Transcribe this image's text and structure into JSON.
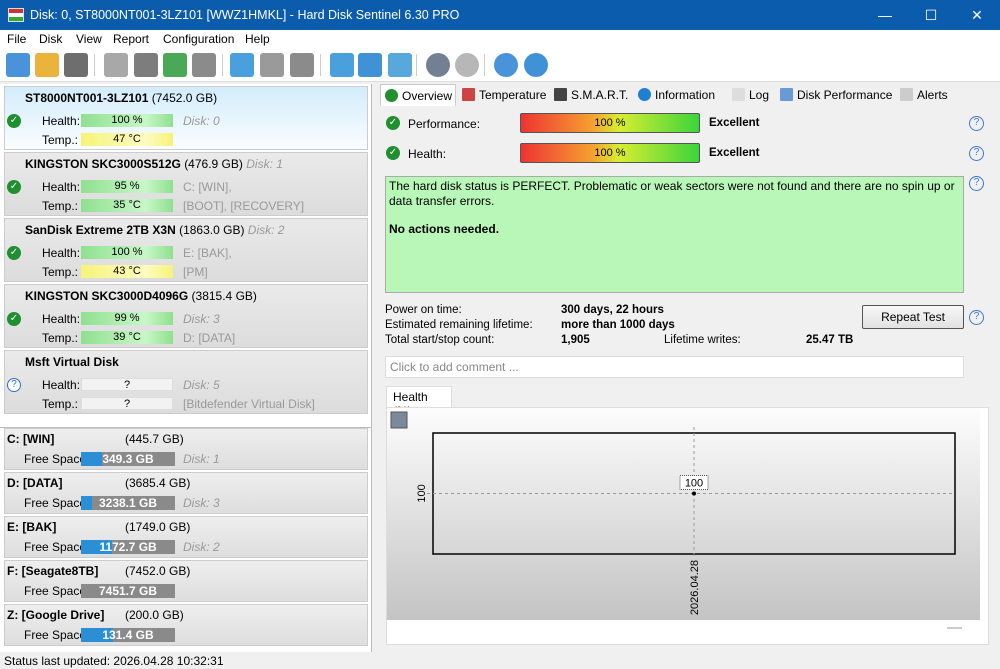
{
  "window": {
    "title": "Disk: 0, ST8000NT001-3LZ101 [WWZ1HMKL]  -  Hard Disk Sentinel 6.30 PRO",
    "minimize": "—",
    "maximize": "☐",
    "close": "✕"
  },
  "menu": [
    "File",
    "Disk",
    "View",
    "Report",
    "Configuration",
    "Help"
  ],
  "toolbar": [
    "refresh-icon",
    "refresh-warning-icon",
    "disk-list-icon",
    "disk-gray-icon",
    "disk-schedule-icon",
    "disk-check-icon",
    "disk-search-icon",
    "network-disk-icon",
    "usb-disk-icon",
    "external-disk-icon",
    "report-icon",
    "email-icon",
    "network-icon",
    "settings-icon",
    "sound-icon",
    "help-icon",
    "info-icon"
  ],
  "disks": [
    {
      "name": "ST8000NT001-3LZ101",
      "size": "(7452.0 GB)",
      "disk_inline": "",
      "status": "ok",
      "health_label": "Health:",
      "health": "100 %",
      "health_color": "g",
      "temp_label": "Temp.:",
      "temp": "47 °C",
      "temp_color": "y",
      "side1": "Disk: 0",
      "side2": "",
      "selected": true
    },
    {
      "name": "KINGSTON SKC3000S512G",
      "size": "(476.9 GB)",
      "disk_inline": "Disk: 1",
      "status": "ok",
      "health_label": "Health:",
      "health": "95 %",
      "health_color": "g",
      "temp_label": "Temp.:",
      "temp": "35 °C",
      "temp_color": "g",
      "side1": "C: [WIN],",
      "side2": "[BOOT],  [RECOVERY]"
    },
    {
      "name": "SanDisk Extreme 2TB X3N",
      "size": "(1863.0 GB)",
      "disk_inline": "Disk: 2",
      "status": "ok",
      "health_label": "Health:",
      "health": "100 %",
      "health_color": "g",
      "temp_label": "Temp.:",
      "temp": "43 °C",
      "temp_color": "y",
      "side1": "E: [BAK],",
      "side2": "[PM]"
    },
    {
      "name": "KINGSTON SKC3000D4096G",
      "size": "(3815.4 GB)",
      "disk_inline": "",
      "status": "ok",
      "health_label": "Health:",
      "health": "99 %",
      "health_color": "g",
      "temp_label": "Temp.:",
      "temp": "39 °C",
      "temp_color": "g",
      "side1": "Disk: 3",
      "side2": "D: [DATA]"
    },
    {
      "name": "Msft    Virtual Disk",
      "size": "",
      "disk_inline": "",
      "status": "unknown",
      "health_label": "Health:",
      "health": "?",
      "health_color": "e",
      "temp_label": "Temp.:",
      "temp": "?",
      "temp_color": "e",
      "side1": "Disk: 5",
      "side2": "[Bitdefender Virtual Disk]"
    }
  ],
  "volumes": [
    {
      "name": "C: [WIN]",
      "size": "(445.7 GB)",
      "free_label": "Free Space",
      "free": "349.3 GB",
      "used_pct": 22,
      "disk": "Disk: 1"
    },
    {
      "name": "D: [DATA]",
      "size": "(3685.4 GB)",
      "free_label": "Free Space",
      "free": "3238.1 GB",
      "used_pct": 12,
      "disk": "Disk: 3"
    },
    {
      "name": "E: [BAK]",
      "size": "(1749.0 GB)",
      "free_label": "Free Space",
      "free": "1172.7 GB",
      "used_pct": 33,
      "disk": "Disk: 2"
    },
    {
      "name": "F: [Seagate8TB]",
      "size": "(7452.0 GB)",
      "free_label": "Free Space",
      "free": "7451.7 GB",
      "used_pct": 0,
      "disk": ""
    },
    {
      "name": "Z: [Google Drive]",
      "size": "(200.0 GB)",
      "free_label": "Free Space",
      "free": "131.4 GB",
      "used_pct": 34,
      "disk": ""
    }
  ],
  "status": "Status last updated: 2026.04.28 10:32:31",
  "tabs": [
    "Overview",
    "Temperature",
    "S.M.A.R.T.",
    "Information",
    "Log",
    "Disk Performance",
    "Alerts"
  ],
  "overview": {
    "performance_label": "Performance:",
    "performance": "100 %",
    "performance_pct": 100,
    "performance_rating": "Excellent",
    "health_label": "Health:",
    "health": "100 %",
    "health_pct": 100,
    "health_rating": "Excellent",
    "message": "The hard disk status is PERFECT. Problematic or weak sectors were not found and there are no spin up or data transfer errors.",
    "message_bold": "No actions needed.",
    "power_on_label": "Power on time:",
    "power_on": "300 days, 22 hours",
    "lifetime_label": "Estimated remaining lifetime:",
    "lifetime": "more than 1000 days",
    "startstop_label": "Total start/stop count:",
    "startstop": "1,905",
    "writes_label": "Lifetime writes:",
    "writes": "25.47 TB",
    "repeat_test": "Repeat Test",
    "comment_placeholder": "Click to add comment ...",
    "chart_tab": "Health (%)"
  },
  "chart_data": {
    "type": "line",
    "title": "Health (%)",
    "x": [
      "2026.04.28"
    ],
    "values": [
      100
    ],
    "y_ticks": [
      "100"
    ],
    "x_ticks": [
      "2026.04.28"
    ],
    "data_labels": [
      "100"
    ],
    "grid": true
  }
}
